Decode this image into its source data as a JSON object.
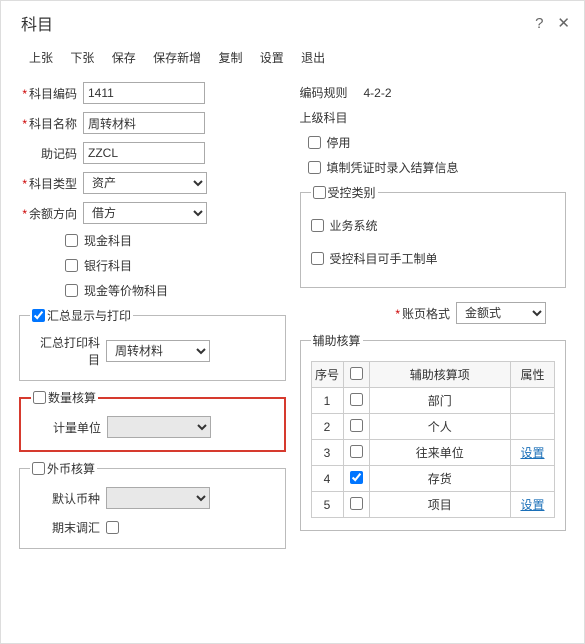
{
  "header": {
    "title": "科目"
  },
  "toolbar": {
    "prev": "上张",
    "next": "下张",
    "save": "保存",
    "save_new": "保存新增",
    "copy": "复制",
    "settings": "设置",
    "exit": "退出"
  },
  "left": {
    "code_lbl": "科目编码",
    "code_val": "1411",
    "name_lbl": "科目名称",
    "name_val": "周转材料",
    "mnemonic_lbl": "助记码",
    "mnemonic_val": "ZZCL",
    "type_lbl": "科目类型",
    "type_val": "资产",
    "dir_lbl": "余额方向",
    "dir_val": "借方",
    "cash_chk": "现金科目",
    "bank_chk": "银行科目",
    "equiv_chk": "现金等价物科目",
    "sum_print_title": "汇总显示与打印",
    "sum_print_lbl": "汇总打印科目",
    "sum_print_val": "周转材料",
    "qty_title": "数量核算",
    "unit_lbl": "计量单位",
    "unit_val": "",
    "fx_title": "外币核算",
    "default_cur_lbl": "默认币种",
    "default_cur_val": "",
    "endadj_lbl": "期末调汇"
  },
  "right": {
    "rule_lbl": "编码规则",
    "rule_val": "4-2-2",
    "parent_lbl": "上级科目",
    "disable_lbl": "停用",
    "voucher_lbl": "填制凭证时录入结算信息",
    "ctrl_title": "受控类别",
    "biz_lbl": "业务系统",
    "manual_lbl": "受控科目可手工制单",
    "format_lbl": "账页格式",
    "format_val": "金额式",
    "aux_title": "辅助核算",
    "thead": {
      "idx": "序号",
      "chk": "",
      "item": "辅助核算项",
      "attr": "属性"
    },
    "rows": [
      {
        "idx": "1",
        "item": "部门",
        "attr": "",
        "chk": false
      },
      {
        "idx": "2",
        "item": "个人",
        "attr": "",
        "chk": false
      },
      {
        "idx": "3",
        "item": "往来单位",
        "attr": "设置",
        "chk": false
      },
      {
        "idx": "4",
        "item": "存货",
        "attr": "",
        "chk": true
      },
      {
        "idx": "5",
        "item": "项目",
        "attr": "设置",
        "chk": false
      }
    ]
  }
}
